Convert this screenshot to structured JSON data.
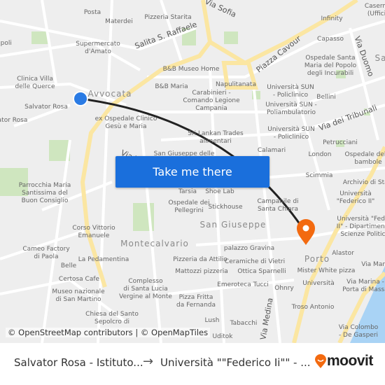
{
  "map": {
    "labels": [
      "Posta",
      "Materdei",
      "Pizzeria Starita",
      "Supermercato\nd'Amato",
      "apoli",
      "Clinica Villa\ndelle Querce",
      "Salvator Rosa",
      "ator Rosa",
      "B&B Museo Home",
      "B&B Maria",
      "Napulitanata",
      "Carabinieri -\nComando Legione\nCampania",
      "ex Ospedale Clinico\nGesù e Maria",
      "Sri Lankan Trades\nalimentari",
      "San Giuseppe delle",
      "Infinity",
      "Capasso",
      "Ospedale Santa\nMaria del Popolo\ndegli Incurabili",
      "Università SUN\n- Policlinico",
      "Bellini",
      "Università SUN -\nPoliambulatorio",
      "Università SUN\n- Policlinico",
      "Petrucciani",
      "Calamari",
      "London",
      "Ospedale delle\nbambole",
      "Scimmia",
      "Archivio di Stat",
      "Parrocchia Maria\nSantissima del\nBuon Consiglio",
      "Tarsia",
      "Shoe Lab",
      "Ospedale dei\nPellegrini",
      "Stickhouse",
      "Campanile di\nSanta Chiara",
      "Università\n\"Federico II\"",
      "Università \"Federic\nII\" - Dipartimento d\nScienze Politiche",
      "Corso Vittorio\nEmanuele",
      "Cameo Factory\ndi Paola",
      "La Pedamentina",
      "Belle",
      "Certosa Cafe",
      "Museo nazionale\ndi San Martino",
      "Complesso\ndi Santa Lucia\nVergine al Monte",
      "Pizzeria da Attilio",
      "palazzo Gravina",
      "Ceramiche di Vietri",
      "Mattozzi pizzeria",
      "Ottica Sparnelli",
      "Emeroteca Tucci",
      "Mister White pizza",
      "Alastor",
      "Ohnry",
      "Università",
      "Troso Antonio",
      "Via Marina",
      "Via Marina -\nPorta di Massa",
      "Pizza Fritta\nda Fernanda",
      "Chiesa del Santo\nSepolcro di",
      "Lush",
      "Tabacchi",
      "Uditok",
      "Via Colombo\n- De Gasperi",
      "Caserm\n(Uffici"
    ],
    "areas": [
      "Avvocata",
      "Montecalvario",
      "San Giuseppe",
      "Porto",
      "Sa"
    ],
    "roads": [
      "Salita S. Raffaele",
      "Piazza Cavour",
      "Via Duomo",
      "Via dei Tribunali",
      "Via V",
      "Via Medina",
      "Via Sofia"
    ],
    "cta_label": "Take me there",
    "attribution": "© OpenStreetMap contributors | © OpenMapTiles",
    "origin_marker_color": "#2a7be4",
    "destination_marker_color": "#f36a10",
    "route_color": "#222222"
  },
  "footer": {
    "from": "Salvator Rosa - Istituto...",
    "arrow": "→",
    "to": "Università \"\"Federico Ii\"\" - ...",
    "brand": "moovit",
    "brand_color": "#f36a10"
  }
}
